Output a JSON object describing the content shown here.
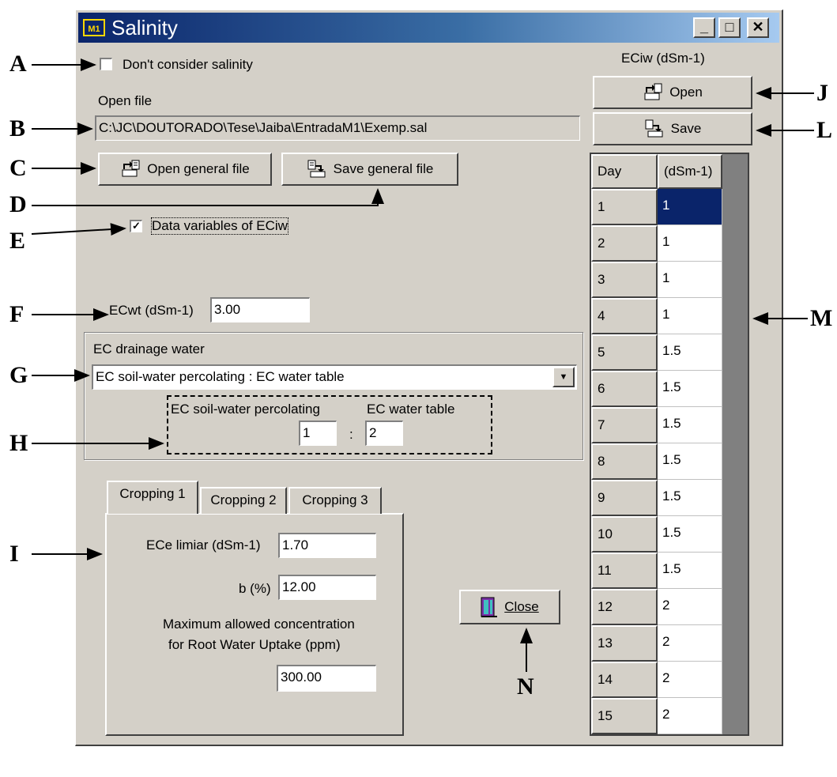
{
  "window": {
    "title": "Salinity",
    "icon_text": "M1",
    "minimize": "_",
    "maximize": "□",
    "close": "✕"
  },
  "salinity_options": {
    "dont_consider_label": "Don't consider salinity",
    "dont_consider_checked": false,
    "open_file_label": "Open file",
    "file_path": "C:\\JC\\DOUTORADO\\Tese\\Jaiba\\EntradaM1\\Exemp.sal",
    "open_general_label": "Open general file",
    "save_general_label": "Save general file",
    "data_variables_label": "Data variables of ECiw",
    "data_variables_checked": true,
    "ecwt_label": "ECwt (dSm-1)",
    "ecwt_value": "3.00"
  },
  "drainage": {
    "group_label": "EC drainage water",
    "select_value": "EC soil-water percolating : EC water table",
    "percolating_label": "EC soil-water percolating",
    "water_table_label": "EC water table",
    "percolating_value": "1",
    "separator": ":",
    "water_table_value": "2"
  },
  "cropping": {
    "tabs": [
      "Cropping 1",
      "Cropping 2",
      "Cropping 3"
    ],
    "active_tab": "Cropping 1",
    "ece_label": "ECe limiar (dSm-1)",
    "ece_value": "1.70",
    "b_label": "b (%)",
    "b_value": "12.00",
    "max_conc_line1": "Maximum allowed concentration",
    "max_conc_line2": "for Root Water Uptake (ppm)",
    "max_conc_value": "300.00"
  },
  "close_label": "Close",
  "eciw": {
    "title": "ECiw (dSm-1)",
    "open_label": "Open",
    "save_label": "Save",
    "columns": [
      "Day",
      "(dSm-1)"
    ],
    "rows": [
      {
        "day": "1",
        "value": "1"
      },
      {
        "day": "2",
        "value": "1"
      },
      {
        "day": "3",
        "value": "1"
      },
      {
        "day": "4",
        "value": "1"
      },
      {
        "day": "5",
        "value": "1.5"
      },
      {
        "day": "6",
        "value": "1.5"
      },
      {
        "day": "7",
        "value": "1.5"
      },
      {
        "day": "8",
        "value": "1.5"
      },
      {
        "day": "9",
        "value": "1.5"
      },
      {
        "day": "10",
        "value": "1.5"
      },
      {
        "day": "11",
        "value": "1.5"
      },
      {
        "day": "12",
        "value": "2"
      },
      {
        "day": "13",
        "value": "2"
      },
      {
        "day": "14",
        "value": "2"
      },
      {
        "day": "15",
        "value": "2"
      }
    ],
    "selected_row": 0
  },
  "annotations": [
    "A",
    "B",
    "C",
    "D",
    "E",
    "F",
    "G",
    "H",
    "I",
    "J",
    "L",
    "M",
    "N"
  ]
}
